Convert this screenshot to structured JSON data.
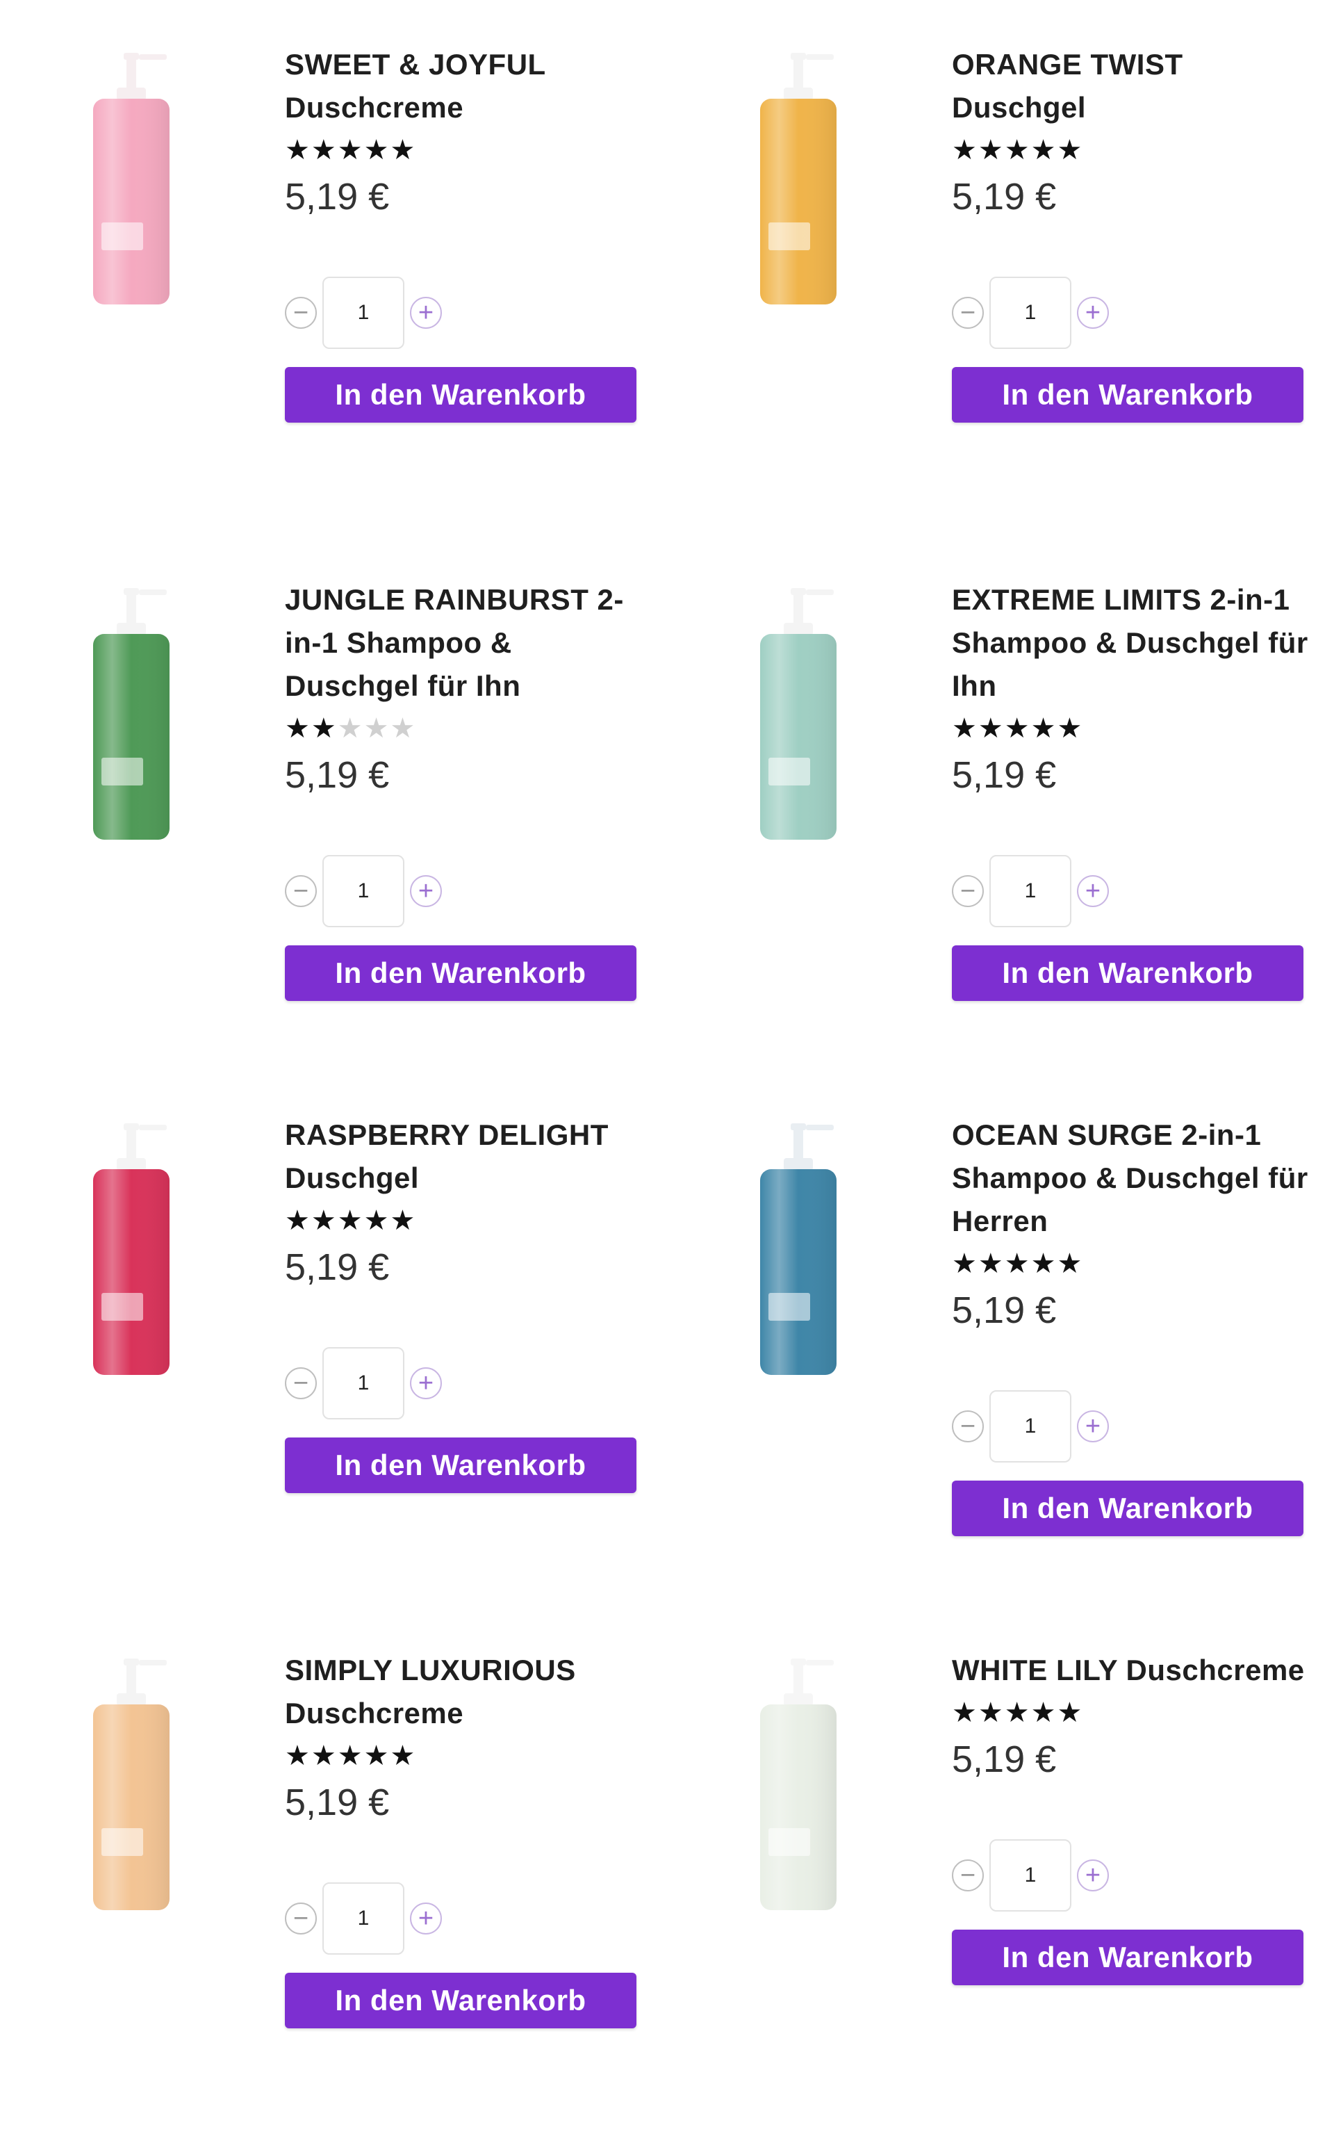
{
  "products": [
    {
      "name_lines": [
        "SWEET & JOYFUL",
        "Duschcreme"
      ],
      "rating": 4.8,
      "stars_max": 5,
      "price": "5,19 €",
      "quantity": "1",
      "cart_label": "In den Warenkorb",
      "bottle_color": "#f5a9c0",
      "cap_color": "#f6eef0"
    },
    {
      "name_lines": [
        "ORANGE TWIST",
        "Duschgel"
      ],
      "rating": 4.7,
      "stars_max": 5,
      "price": "5,19 €",
      "quantity": "1",
      "cart_label": "In den Warenkorb",
      "bottle_color": "#f0b44a",
      "cap_color": "#f4f4f4"
    },
    {
      "name_lines": [
        "JUNGLE RAINBURST 2-",
        "in-1 Shampoo &",
        "Duschgel für Ihn"
      ],
      "rating": 2,
      "stars_max": 5,
      "price": "5,19 €",
      "quantity": "1",
      "cart_label": "In den Warenkorb",
      "bottle_color": "#4f9a57",
      "cap_color": "#f4f4f4"
    },
    {
      "name_lines": [
        "EXTREME LIMITS 2-in-1",
        "Shampoo & Duschgel für",
        "Ihn"
      ],
      "rating": 5,
      "stars_max": 5,
      "price": "5,19 €",
      "quantity": "1",
      "cart_label": "In den Warenkorb",
      "bottle_color": "#9fcfc3",
      "cap_color": "#f4f4f4"
    },
    {
      "name_lines": [
        "RASPBERRY DELIGHT",
        "Duschgel"
      ],
      "rating": 5,
      "stars_max": 5,
      "price": "5,19 €",
      "quantity": "1",
      "cart_label": "In den Warenkorb",
      "bottle_color": "#d9335a",
      "cap_color": "#f4f4f4"
    },
    {
      "name_lines": [
        "OCEAN SURGE 2-in-1",
        "Shampoo & Duschgel für",
        "Herren"
      ],
      "rating": 5,
      "stars_max": 5,
      "price": "5,19 €",
      "quantity": "1",
      "cart_label": "In den Warenkorb",
      "bottle_color": "#3f86a8",
      "cap_color": "#e9eef2"
    },
    {
      "name_lines": [
        "SIMPLY LUXURIOUS",
        "Duschcreme"
      ],
      "rating": 4.7,
      "stars_max": 5,
      "price": "5,19 €",
      "quantity": "1",
      "cart_label": "In den Warenkorb",
      "bottle_color": "#f3c494",
      "cap_color": "#f4f4f4"
    },
    {
      "name_lines": [
        "WHITE LILY Duschcreme"
      ],
      "rating": 5,
      "stars_max": 5,
      "price": "5,19 €",
      "quantity": "1",
      "cart_label": "In den Warenkorb",
      "bottle_color": "#e9efe6",
      "cap_color": "#f6f6f6"
    }
  ],
  "colors": {
    "accent": "#7d2fd1",
    "star": "#111111",
    "star_empty": "#d0d0d0"
  },
  "icons": {
    "minus": "minus-circle-icon",
    "plus": "plus-circle-icon",
    "star": "star-icon"
  }
}
